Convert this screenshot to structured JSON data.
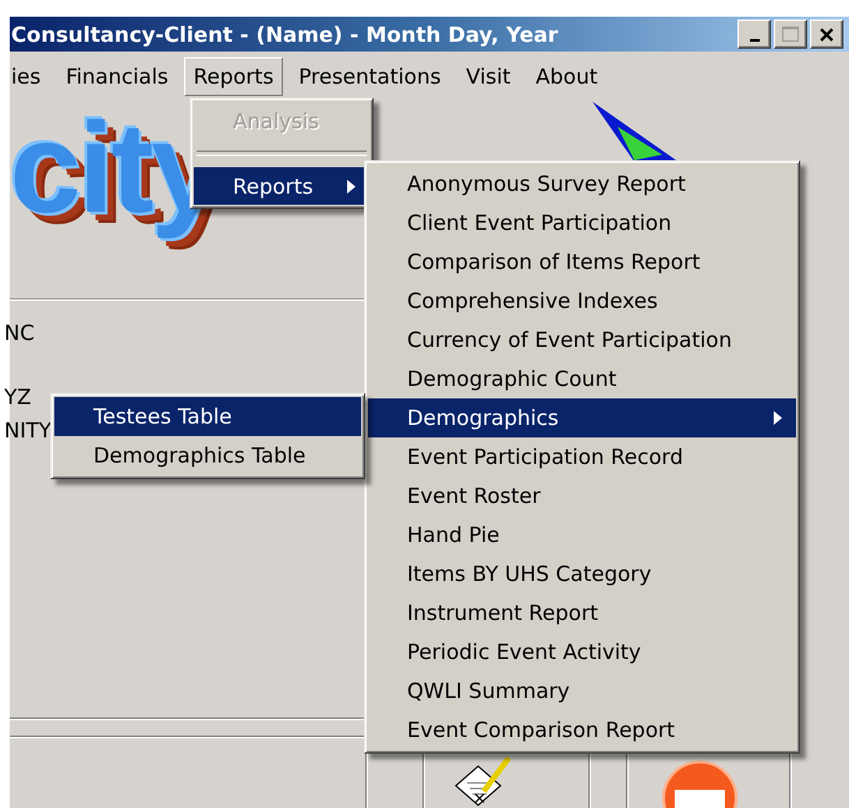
{
  "window": {
    "title": "Consultancy-Client - (Name) - Month Day, Year"
  },
  "menubar": [
    {
      "label": "ies",
      "selected": false
    },
    {
      "label": "Financials",
      "selected": false
    },
    {
      "label": "Reports",
      "selected": true
    },
    {
      "label": "Presentations",
      "selected": false
    },
    {
      "label": "Visit",
      "selected": false
    },
    {
      "label": "About",
      "selected": false
    }
  ],
  "background": {
    "logo": "city",
    "labels": [
      "NC",
      "YZ",
      "NITY"
    ]
  },
  "reports_menu": {
    "items": [
      {
        "kind": "item",
        "label": "Analysis",
        "disabled": true,
        "selected": false
      },
      {
        "kind": "separator"
      },
      {
        "kind": "submenu",
        "label": "Reports",
        "disabled": false,
        "selected": true
      }
    ]
  },
  "reports_submenu": {
    "items": [
      {
        "kind": "item",
        "label": "Anonymous Survey Report",
        "selected": false
      },
      {
        "kind": "item",
        "label": "Client Event Participation",
        "selected": false
      },
      {
        "kind": "item",
        "label": "Comparison of Items Report",
        "selected": false
      },
      {
        "kind": "item",
        "label": "Comprehensive Indexes",
        "selected": false
      },
      {
        "kind": "item",
        "label": "Currency of Event Participation",
        "selected": false
      },
      {
        "kind": "item",
        "label": "Demographic Count",
        "selected": false
      },
      {
        "kind": "submenu",
        "label": "Demographics",
        "selected": true
      },
      {
        "kind": "item",
        "label": "Event Participation Record",
        "selected": false
      },
      {
        "kind": "item",
        "label": "Event Roster",
        "selected": false
      },
      {
        "kind": "item",
        "label": "Hand Pie",
        "selected": false
      },
      {
        "kind": "item",
        "label": "Items BY UHS Category",
        "selected": false
      },
      {
        "kind": "item",
        "label": "Instrument Report",
        "selected": false
      },
      {
        "kind": "item",
        "label": "Periodic Event Activity",
        "selected": false
      },
      {
        "kind": "item",
        "label": "QWLI Summary",
        "selected": false
      },
      {
        "kind": "item",
        "label": "Event Comparison Report",
        "selected": false
      }
    ]
  },
  "demographics_submenu": {
    "items": [
      {
        "kind": "item",
        "label": "Testees Table",
        "selected": true
      },
      {
        "kind": "item",
        "label": "Demographics Table",
        "selected": false
      }
    ]
  }
}
